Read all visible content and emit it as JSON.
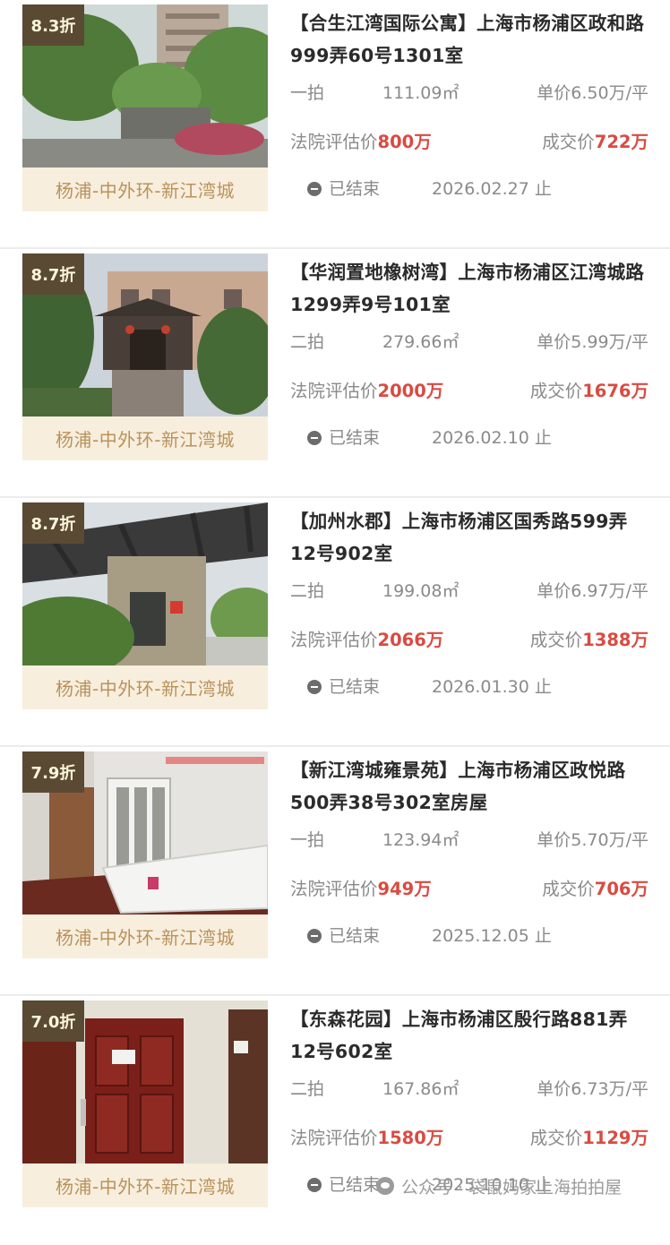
{
  "listings": [
    {
      "discount": "8.3折",
      "region": "杨浦-中外环-新江湾城",
      "title": "【合生江湾国际公寓】上海市杨浦区政和路999弄60号1301室",
      "round": "一拍",
      "area": "111.09㎡",
      "unit_price": "单价6.50万/平",
      "appraisal_label": "法院评估价",
      "appraisal_value": "800万",
      "deal_label": "成交价",
      "deal_value": "722万",
      "status": "已结束",
      "end_date": "2026.02.27 止",
      "photo": "residential-tower-garden"
    },
    {
      "discount": "8.7折",
      "region": "杨浦-中外环-新江湾城",
      "title": "【华润置地橡树湾】上海市杨浦区江湾城路1299弄9号101室",
      "round": "二拍",
      "area": "279.66㎡",
      "unit_price": "单价5.99万/平",
      "appraisal_label": "法院评估价",
      "appraisal_value": "2000万",
      "deal_label": "成交价",
      "deal_value": "1676万",
      "status": "已结束",
      "end_date": "2026.02.10 止",
      "photo": "townhouse-entrance"
    },
    {
      "discount": "8.7折",
      "region": "杨浦-中外环-新江湾城",
      "title": "【加州水郡】上海市杨浦区国秀路599弄12号902室",
      "round": "二拍",
      "area": "199.08㎡",
      "unit_price": "单价6.97万/平",
      "appraisal_label": "法院评估价",
      "appraisal_value": "2066万",
      "deal_label": "成交价",
      "deal_value": "1388万",
      "status": "已结束",
      "end_date": "2026.01.30 止",
      "photo": "pergola-building-entrance"
    },
    {
      "discount": "7.9折",
      "region": "杨浦-中外环-新江湾城",
      "title": "【新江湾城雍景苑】上海市杨浦区政悦路500弄38号302室房屋",
      "round": "一拍",
      "area": "123.94㎡",
      "unit_price": "单价5.70万/平",
      "appraisal_label": "法院评估价",
      "appraisal_value": "949万",
      "deal_label": "成交价",
      "deal_value": "706万",
      "status": "已结束",
      "end_date": "2025.12.05 止",
      "photo": "bedroom-interior"
    },
    {
      "discount": "7.0折",
      "region": "杨浦-中外环-新江湾城",
      "title": "【东森花园】上海市杨浦区殷行路881弄12号602室",
      "round": "二拍",
      "area": "167.86㎡",
      "unit_price": "单价6.73万/平",
      "appraisal_label": "法院评估价",
      "appraisal_value": "1580万",
      "deal_label": "成交价",
      "deal_value": "1129万",
      "status": "已结束",
      "end_date": "2025.10.10 止",
      "photo": "apartment-door"
    }
  ],
  "watermark": "公众号 · 袋鼠妈家上海拍拍屋",
  "colors": {
    "price_red": "#d94b42",
    "discount_bg": "#5a4a33",
    "region_bg": "#f8eedd",
    "region_text": "#b8925c"
  }
}
